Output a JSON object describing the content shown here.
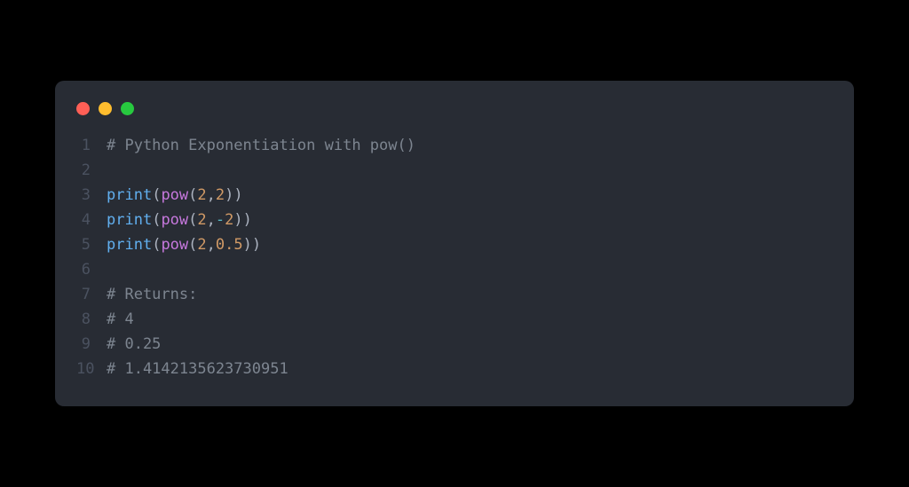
{
  "code": {
    "lines": [
      {
        "num": "1",
        "tokens": [
          {
            "cls": "tok-comment",
            "text": "# Python Exponentiation with pow()"
          }
        ]
      },
      {
        "num": "2",
        "tokens": []
      },
      {
        "num": "3",
        "tokens": [
          {
            "cls": "tok-func",
            "text": "print"
          },
          {
            "cls": "tok-punct",
            "text": "("
          },
          {
            "cls": "tok-call",
            "text": "pow"
          },
          {
            "cls": "tok-punct",
            "text": "("
          },
          {
            "cls": "tok-number",
            "text": "2"
          },
          {
            "cls": "tok-punct",
            "text": ","
          },
          {
            "cls": "tok-number",
            "text": "2"
          },
          {
            "cls": "tok-punct",
            "text": "))"
          }
        ]
      },
      {
        "num": "4",
        "tokens": [
          {
            "cls": "tok-func",
            "text": "print"
          },
          {
            "cls": "tok-punct",
            "text": "("
          },
          {
            "cls": "tok-call",
            "text": "pow"
          },
          {
            "cls": "tok-punct",
            "text": "("
          },
          {
            "cls": "tok-number",
            "text": "2"
          },
          {
            "cls": "tok-punct",
            "text": ","
          },
          {
            "cls": "tok-op",
            "text": "-"
          },
          {
            "cls": "tok-number",
            "text": "2"
          },
          {
            "cls": "tok-punct",
            "text": "))"
          }
        ]
      },
      {
        "num": "5",
        "tokens": [
          {
            "cls": "tok-func",
            "text": "print"
          },
          {
            "cls": "tok-punct",
            "text": "("
          },
          {
            "cls": "tok-call",
            "text": "pow"
          },
          {
            "cls": "tok-punct",
            "text": "("
          },
          {
            "cls": "tok-number",
            "text": "2"
          },
          {
            "cls": "tok-punct",
            "text": ","
          },
          {
            "cls": "tok-number",
            "text": "0.5"
          },
          {
            "cls": "tok-punct",
            "text": "))"
          }
        ]
      },
      {
        "num": "6",
        "tokens": []
      },
      {
        "num": "7",
        "tokens": [
          {
            "cls": "tok-comment",
            "text": "# Returns:"
          }
        ]
      },
      {
        "num": "8",
        "tokens": [
          {
            "cls": "tok-comment",
            "text": "# 4"
          }
        ]
      },
      {
        "num": "9",
        "tokens": [
          {
            "cls": "tok-comment",
            "text": "# 0.25"
          }
        ]
      },
      {
        "num": "10",
        "tokens": [
          {
            "cls": "tok-comment",
            "text": "# 1.4142135623730951"
          }
        ]
      }
    ]
  }
}
